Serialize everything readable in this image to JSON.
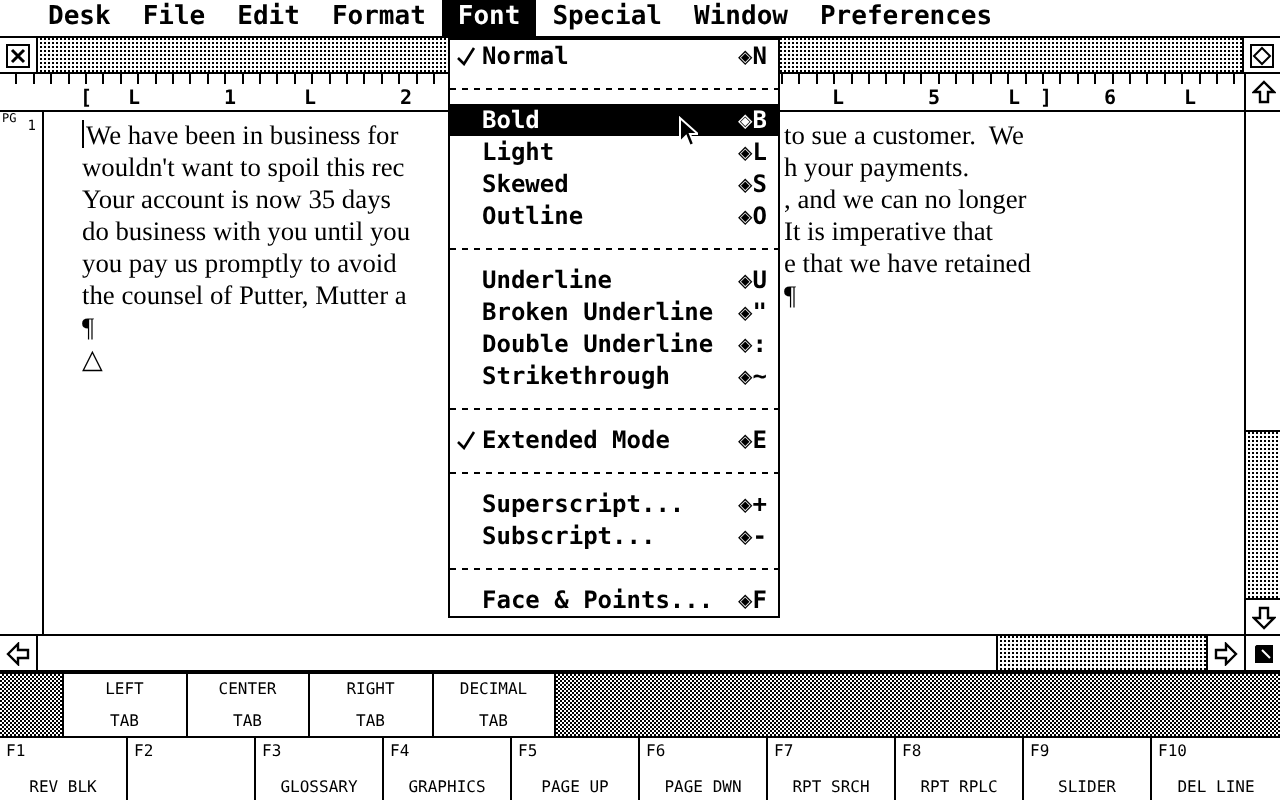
{
  "menu_bar": [
    {
      "label": "Desk",
      "selected": false
    },
    {
      "label": "File",
      "selected": false
    },
    {
      "label": "Edit",
      "selected": false
    },
    {
      "label": "Format",
      "selected": false
    },
    {
      "label": "Font",
      "selected": true
    },
    {
      "label": "Special",
      "selected": false
    },
    {
      "label": "Window",
      "selected": false
    },
    {
      "label": "Preferences",
      "selected": false
    }
  ],
  "font_menu": {
    "items": [
      {
        "kind": "item",
        "label": "Normal",
        "shortcut": "◈N",
        "checked": true,
        "selected": false
      },
      {
        "kind": "separator"
      },
      {
        "kind": "item",
        "label": "Bold",
        "shortcut": "◈B",
        "checked": false,
        "selected": true
      },
      {
        "kind": "item",
        "label": "Light",
        "shortcut": "◈L",
        "checked": false,
        "selected": false
      },
      {
        "kind": "item",
        "label": "Skewed",
        "shortcut": "◈S",
        "checked": false,
        "selected": false
      },
      {
        "kind": "item",
        "label": "Outline",
        "shortcut": "◈O",
        "checked": false,
        "selected": false
      },
      {
        "kind": "separator"
      },
      {
        "kind": "item",
        "label": "Underline",
        "shortcut": "◈U",
        "checked": false,
        "selected": false
      },
      {
        "kind": "item",
        "label": "Broken Underline",
        "shortcut": "◈\"",
        "checked": false,
        "selected": false
      },
      {
        "kind": "item",
        "label": "Double Underline",
        "shortcut": "◈:",
        "checked": false,
        "selected": false
      },
      {
        "kind": "item",
        "label": "Strikethrough",
        "shortcut": "◈~",
        "checked": false,
        "selected": false
      },
      {
        "kind": "separator"
      },
      {
        "kind": "item",
        "label": "Extended Mode",
        "shortcut": "◈E",
        "checked": true,
        "selected": false
      },
      {
        "kind": "separator"
      },
      {
        "kind": "item",
        "label": "Superscript...",
        "shortcut": "◈+",
        "checked": false,
        "selected": false
      },
      {
        "kind": "item",
        "label": "Subscript...",
        "shortcut": "◈-",
        "checked": false,
        "selected": false
      },
      {
        "kind": "separator"
      },
      {
        "kind": "item",
        "label": "Face & Points...",
        "shortcut": "◈F",
        "checked": false,
        "selected": false
      }
    ]
  },
  "ruler": {
    "left": "[  L     1    L     2",
    "right": "L     5    L ]   6    L"
  },
  "page_indicator": {
    "label": "PG",
    "number": "1"
  },
  "document": {
    "lines": [
      {
        "left": "We have been in business for",
        "right": "to sue a customer.  We"
      },
      {
        "left": "wouldn't want to spoil this rec",
        "right": "h your payments."
      },
      {
        "left": "Your account is now 35 days",
        "right": ", and we can no longer"
      },
      {
        "left": "do business with you until you",
        "right": "It is imperative that"
      },
      {
        "left": "you pay us promptly to avoid",
        "right": "e that we have retained"
      },
      {
        "left": "the counsel of Putter, Mutter a",
        "right": "¶"
      },
      {
        "left": "¶"
      },
      {
        "left": "△"
      }
    ]
  },
  "tab_buttons": [
    {
      "line1": "LEFT",
      "line2": "TAB"
    },
    {
      "line1": "CENTER",
      "line2": "TAB"
    },
    {
      "line1": "RIGHT",
      "line2": "TAB"
    },
    {
      "line1": "DECIMAL",
      "line2": "TAB"
    }
  ],
  "function_keys": [
    {
      "key": "F1",
      "action": "REV BLK"
    },
    {
      "key": "F2"
    },
    {
      "key": "F3",
      "action": "GLOSSARY"
    },
    {
      "key": "F4",
      "action": "GRAPHICS"
    },
    {
      "key": "F5",
      "action": "PAGE UP"
    },
    {
      "key": "F6",
      "action": "PAGE DWN"
    },
    {
      "key": "F7",
      "action": "RPT SRCH"
    },
    {
      "key": "F8",
      "action": "RPT RPLC"
    },
    {
      "key": "F9",
      "action": "SLIDER"
    },
    {
      "key": "F10",
      "action": "DEL LINE"
    }
  ]
}
